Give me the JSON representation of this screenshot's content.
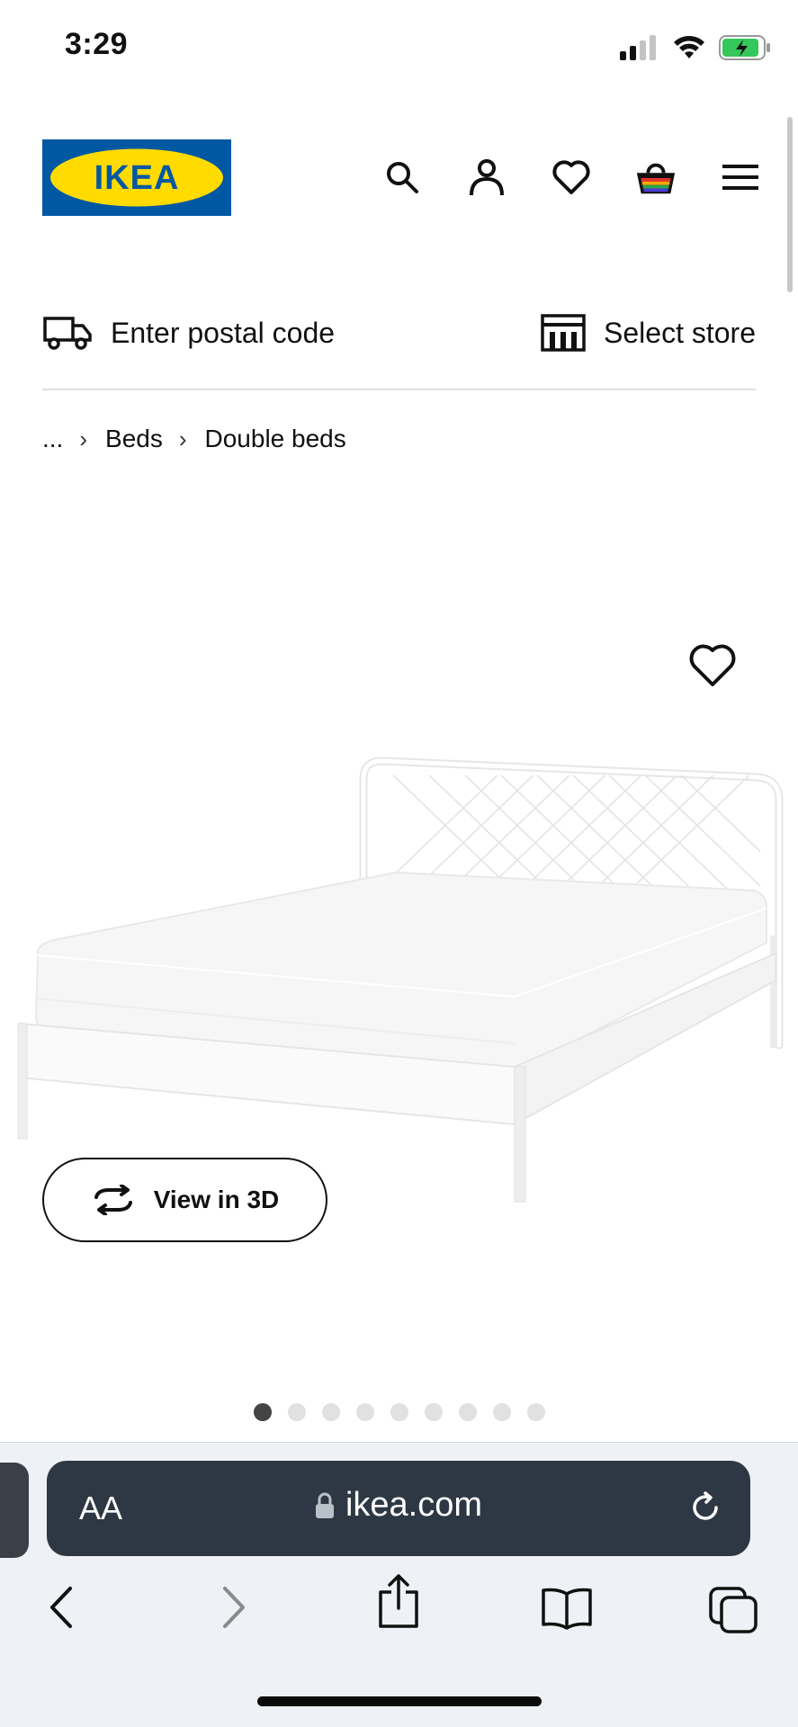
{
  "status_bar": {
    "time": "3:29"
  },
  "header": {
    "logo_text": "IKEA",
    "brand_colors": {
      "blue": "#0058A3",
      "yellow": "#FFDB00"
    },
    "icons": [
      "search-icon",
      "account-icon",
      "heart-icon",
      "basket-icon",
      "menu-icon"
    ]
  },
  "delivery": {
    "postal_label": "Enter postal code",
    "store_label": "Select store"
  },
  "breadcrumb": {
    "ellipsis": "...",
    "items": [
      "Beds",
      "Double beds"
    ]
  },
  "product": {
    "view3d_label": "View in 3D",
    "carousel": {
      "count": 9,
      "active": 1
    }
  },
  "browser": {
    "text_size_label": "AA",
    "url": "ikea.com"
  }
}
